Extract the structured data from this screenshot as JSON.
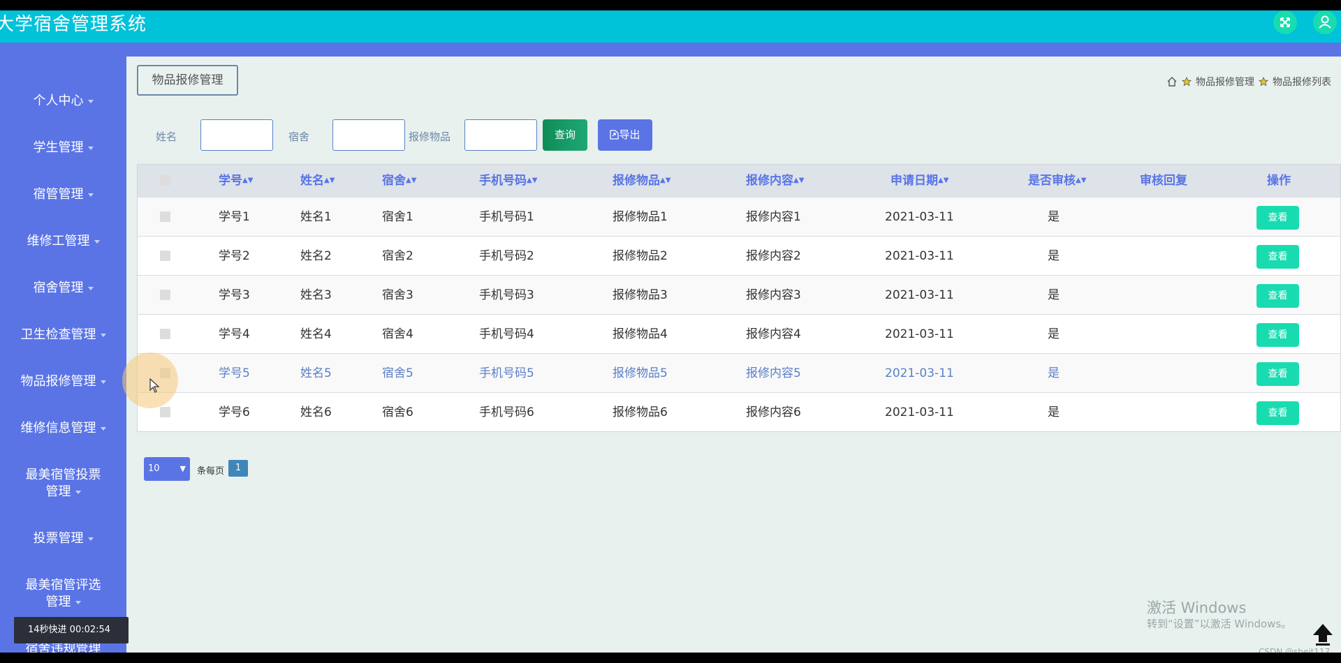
{
  "header": {
    "app_title": "大学宿舍管理系统",
    "fullscreen_icon": "fullscreen-icon",
    "user_icon": "user-icon"
  },
  "sidebar": {
    "items": [
      {
        "label": "个人中心"
      },
      {
        "label": "学生管理"
      },
      {
        "label": "宿管管理"
      },
      {
        "label": "维修工管理"
      },
      {
        "label": "宿舍管理"
      },
      {
        "label": "卫生检查管理"
      },
      {
        "label": "物品报修管理"
      },
      {
        "label": "维修信息管理"
      },
      {
        "label": "最美宿管投票管理"
      },
      {
        "label": "投票管理"
      },
      {
        "label": "最美宿管评选管理"
      },
      {
        "label": "宿舍违规管理"
      }
    ]
  },
  "page": {
    "tab_title": "物品报修管理",
    "breadcrumb": [
      "物品报修管理",
      "物品报修列表"
    ]
  },
  "filters": {
    "name_label": "姓名",
    "name_value": "",
    "dorm_label": "宿舍",
    "dorm_value": "",
    "item_label": "报修物品",
    "item_value": "",
    "query_label": "查询",
    "export_label": "导出"
  },
  "table": {
    "headers": [
      "学号",
      "姓名",
      "宿舍",
      "手机号码",
      "报修物品",
      "报修内容",
      "申请日期",
      "是否审核",
      "审核回复",
      "操作"
    ],
    "view_label": "查看",
    "rows": [
      {
        "id": "学号1",
        "name": "姓名1",
        "dorm": "宿舍1",
        "phone": "手机号码1",
        "item": "报修物品1",
        "content": "报修内容1",
        "date": "2021-03-11",
        "approved": "是",
        "reply": ""
      },
      {
        "id": "学号2",
        "name": "姓名2",
        "dorm": "宿舍2",
        "phone": "手机号码2",
        "item": "报修物品2",
        "content": "报修内容2",
        "date": "2021-03-11",
        "approved": "是",
        "reply": ""
      },
      {
        "id": "学号3",
        "name": "姓名3",
        "dorm": "宿舍3",
        "phone": "手机号码3",
        "item": "报修物品3",
        "content": "报修内容3",
        "date": "2021-03-11",
        "approved": "是",
        "reply": ""
      },
      {
        "id": "学号4",
        "name": "姓名4",
        "dorm": "宿舍4",
        "phone": "手机号码4",
        "item": "报修物品4",
        "content": "报修内容4",
        "date": "2021-03-11",
        "approved": "是",
        "reply": ""
      },
      {
        "id": "学号5",
        "name": "姓名5",
        "dorm": "宿舍5",
        "phone": "手机号码5",
        "item": "报修物品5",
        "content": "报修内容5",
        "date": "2021-03-11",
        "approved": "是",
        "reply": ""
      },
      {
        "id": "学号6",
        "name": "姓名6",
        "dorm": "宿舍6",
        "phone": "手机号码6",
        "item": "报修物品6",
        "content": "报修内容6",
        "date": "2021-03-11",
        "approved": "是",
        "reply": ""
      }
    ]
  },
  "pager": {
    "page_size": "10",
    "per_page_label": "条每页",
    "current_page": "1"
  },
  "overlay": {
    "video_badge": "14秒快进   00:02:54",
    "watermark_title": "激活 Windows",
    "watermark_sub": "转到“设置”以激活 Windows。",
    "csdn": "CSDN @shejt117"
  },
  "colors": {
    "header": "#00c2d9",
    "sidebar": "#5a74e6",
    "accent_green": "#18dcb0",
    "query_green": "#0f8c58"
  }
}
